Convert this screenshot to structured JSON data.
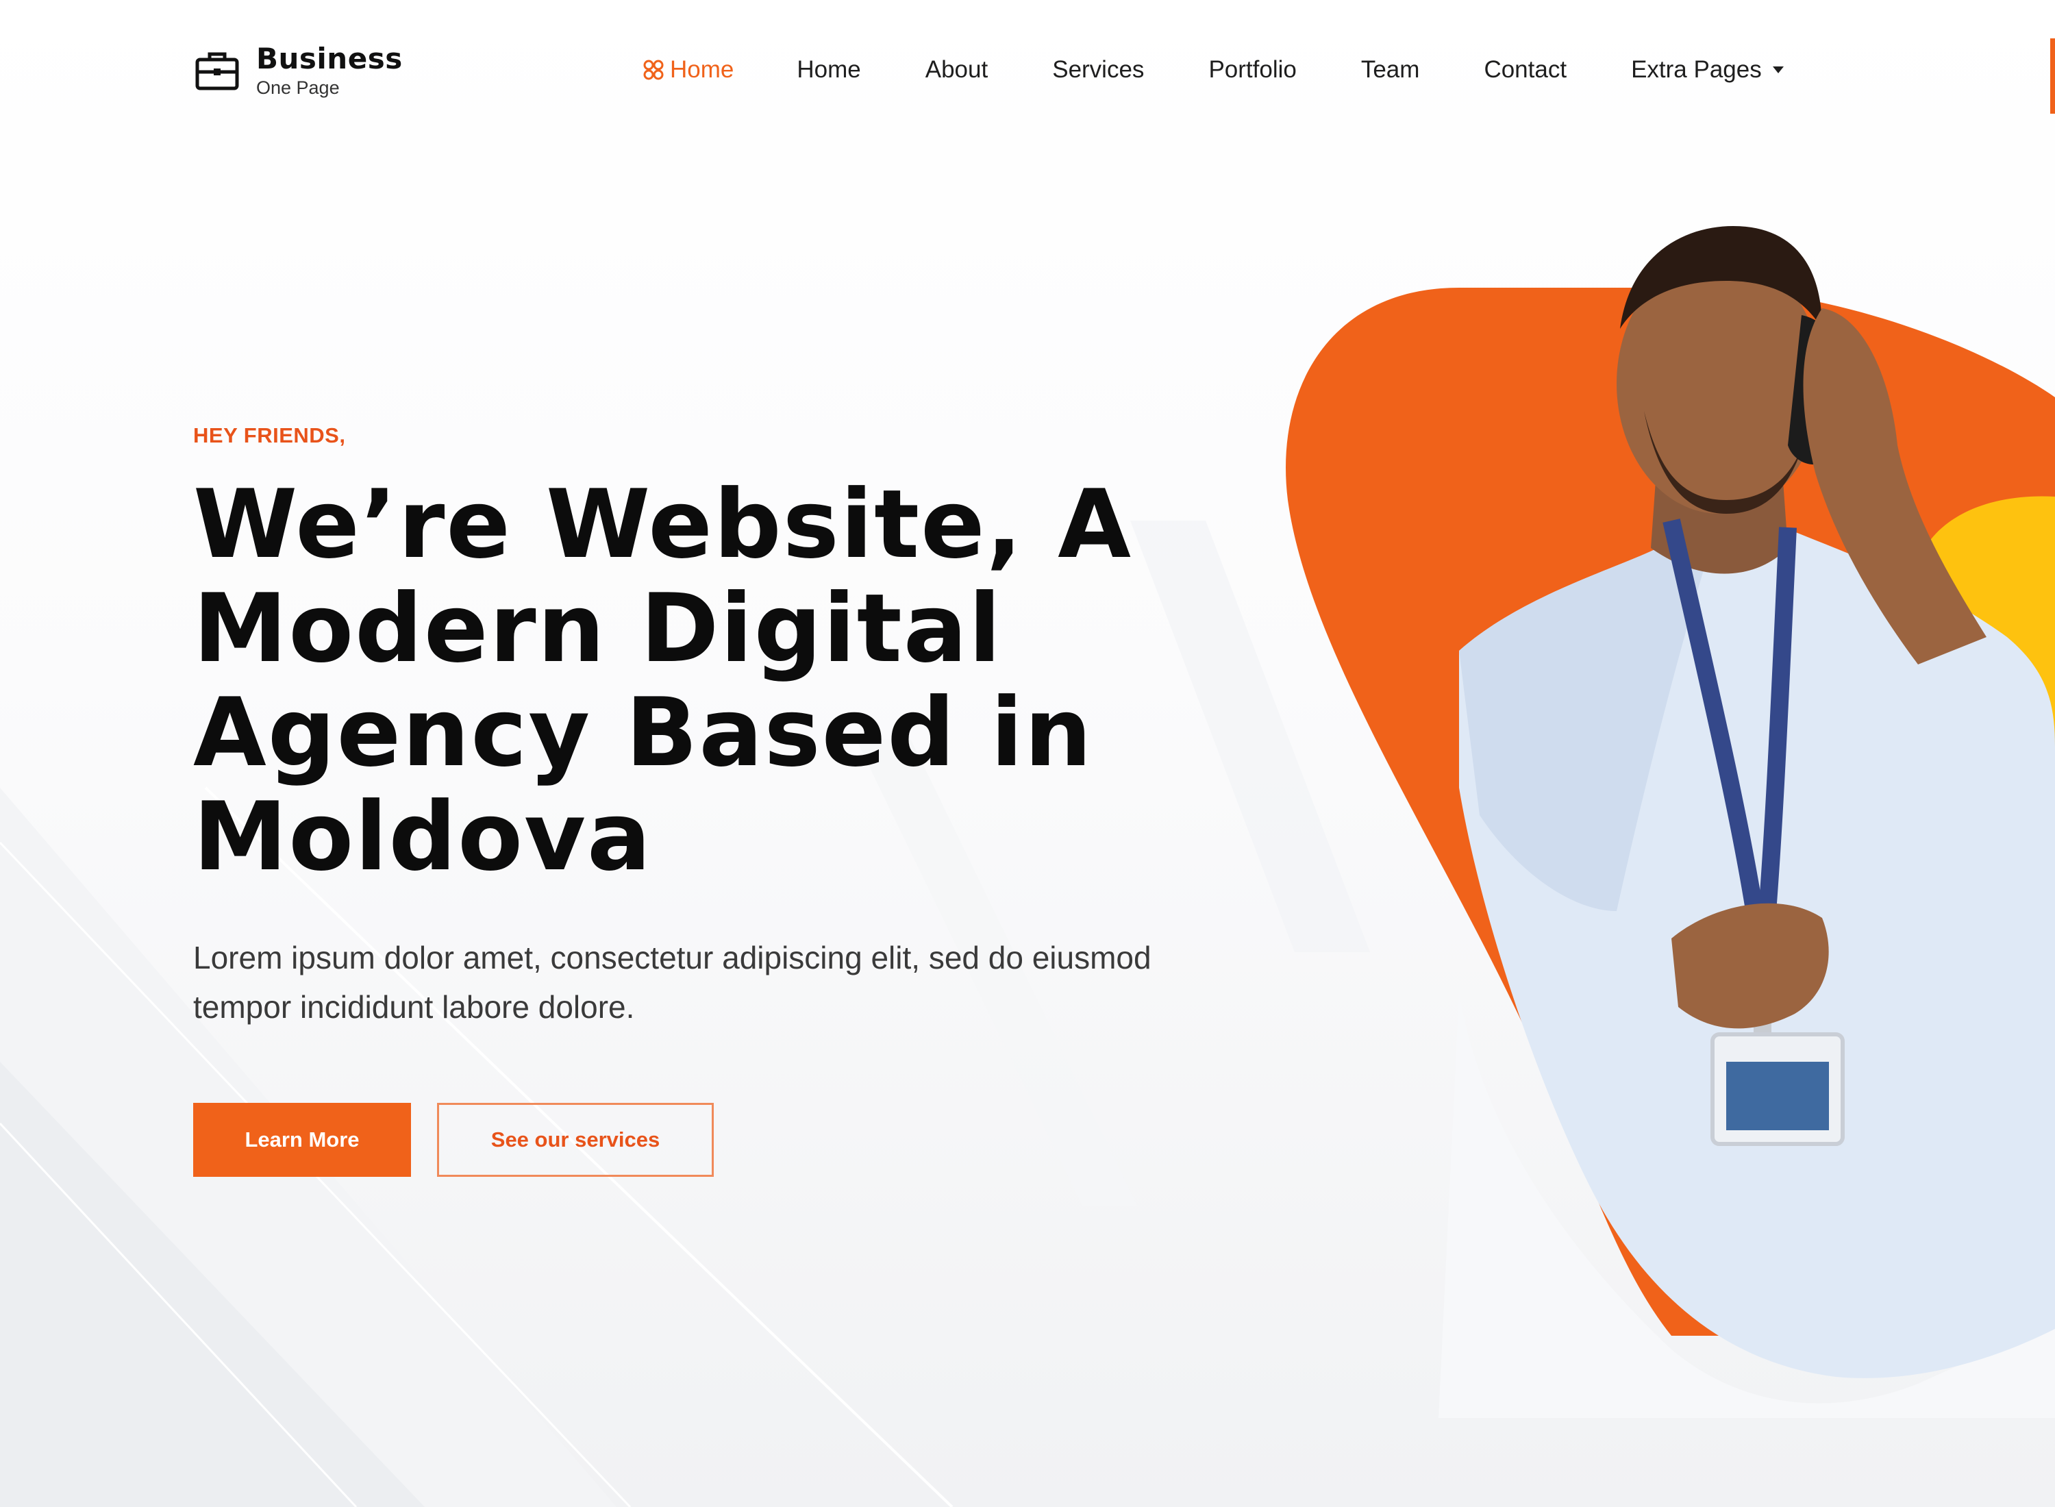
{
  "brand": {
    "name": "Business",
    "tagline": "One Page",
    "icon": "briefcase-icon"
  },
  "nav": {
    "items": [
      {
        "label": "Home",
        "active": true,
        "icon": "grid-icon"
      },
      {
        "label": "Home",
        "active": false
      },
      {
        "label": "About",
        "active": false
      },
      {
        "label": "Services",
        "active": false
      },
      {
        "label": "Portfolio",
        "active": false
      },
      {
        "label": "Team",
        "active": false
      },
      {
        "label": "Contact",
        "active": false
      },
      {
        "label": "Extra Pages",
        "active": false,
        "icon": "caret-down-icon"
      }
    ]
  },
  "hero": {
    "eyebrow": "HEY FRIENDS,",
    "headline_lines": [
      "We’re Website, A",
      "Modern Digital",
      "Agency Based in",
      "Moldova"
    ],
    "lead_lines": [
      "Lorem ipsum dolor amet, consectetur adipiscing elit, sed do eiusmod",
      "tempor incididunt labore dolore."
    ],
    "primary_button": "Learn More",
    "secondary_button": "See our services",
    "image": "man-on-phone-photo"
  },
  "colors": {
    "accent": "#f0621a",
    "accent_yellow": "#fec20f",
    "text_dark": "#0c0c0c",
    "text_body": "#3a3a3a"
  }
}
